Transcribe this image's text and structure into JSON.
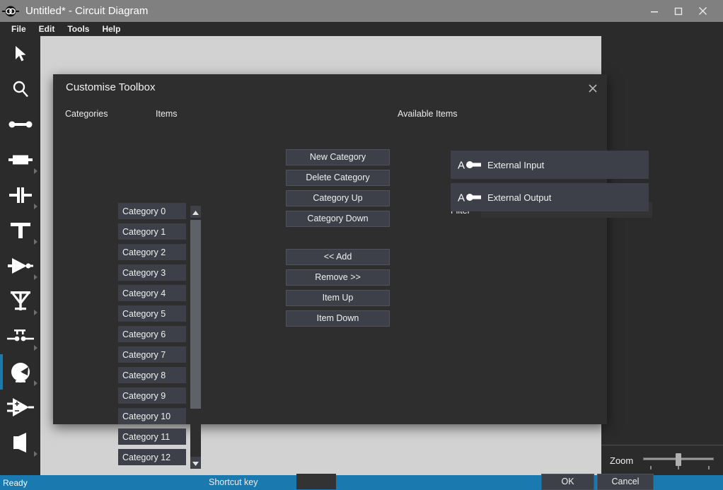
{
  "window": {
    "title": "Untitled* - Circuit Diagram",
    "logo_icon": "circuit-diagram-logo-icon",
    "minimize_icon": "minimize-icon",
    "maximize_icon": "maximize-icon",
    "close_icon": "close-icon"
  },
  "menubar": {
    "items": [
      {
        "label": "File"
      },
      {
        "label": "Edit"
      },
      {
        "label": "Tools"
      },
      {
        "label": "Help"
      }
    ]
  },
  "sidebar": {
    "tools": [
      {
        "name": "select-tool",
        "icon": "cursor-arrow-icon",
        "has_flyout": false,
        "selected": false
      },
      {
        "name": "zoom-tool",
        "icon": "magnifier-icon",
        "has_flyout": false,
        "selected": false
      },
      {
        "name": "wire-tool",
        "icon": "wire-icon",
        "has_flyout": false,
        "selected": false
      },
      {
        "name": "resistor-tool",
        "icon": "resistor-icon",
        "has_flyout": true,
        "selected": false
      },
      {
        "name": "capacitor-tool",
        "icon": "capacitor-icon",
        "has_flyout": true,
        "selected": false
      },
      {
        "name": "junction-tool",
        "icon": "t-junction-icon",
        "has_flyout": true,
        "selected": false
      },
      {
        "name": "buffer-tool",
        "icon": "buffer-triangle-icon",
        "has_flyout": true,
        "selected": false
      },
      {
        "name": "antenna-tool",
        "icon": "antenna-icon",
        "has_flyout": true,
        "selected": false
      },
      {
        "name": "switch-tool",
        "icon": "switch-icon",
        "has_flyout": true,
        "selected": false
      },
      {
        "name": "meter-tool",
        "icon": "meter-gauge-icon",
        "has_flyout": true,
        "selected": true
      },
      {
        "name": "opamp-tool",
        "icon": "op-amp-icon",
        "has_flyout": false,
        "selected": false
      },
      {
        "name": "speaker-tool",
        "icon": "speaker-icon",
        "has_flyout": true,
        "selected": false
      }
    ]
  },
  "zoom_control": {
    "label": "Zoom",
    "value": 50
  },
  "statusbar": {
    "text": "Ready"
  },
  "dialog": {
    "title": "Customise Toolbox",
    "close_icon": "close-icon",
    "headings": {
      "categories": "Categories",
      "items": "Items",
      "available_items": "Available Items"
    },
    "categories": [
      {
        "label": "Category 0"
      },
      {
        "label": "Category 1"
      },
      {
        "label": "Category 2"
      },
      {
        "label": "Category 3"
      },
      {
        "label": "Category 4"
      },
      {
        "label": "Category 5"
      },
      {
        "label": "Category 6"
      },
      {
        "label": "Category 7"
      },
      {
        "label": "Category 8"
      },
      {
        "label": "Category 9"
      },
      {
        "label": "Category 10"
      },
      {
        "label": "Category 11"
      },
      {
        "label": "Category 12"
      }
    ],
    "scrollbar": {
      "up_icon": "scroll-up-arrow-icon",
      "down_icon": "scroll-down-arrow-icon"
    },
    "category_buttons": [
      {
        "label": "New Category"
      },
      {
        "label": "Delete Category"
      },
      {
        "label": "Category Up"
      },
      {
        "label": "Category Down"
      }
    ],
    "item_buttons": [
      {
        "label": "<< Add"
      },
      {
        "label": "Remove >>"
      },
      {
        "label": "Item Up"
      },
      {
        "label": "Item Down"
      }
    ],
    "filter": {
      "label": "Filter",
      "value": "",
      "placeholder": ""
    },
    "available_items": [
      {
        "label": "External Input",
        "icon": "external-input-icon"
      },
      {
        "label": "External Output",
        "icon": "external-output-icon"
      }
    ],
    "shortcut": {
      "label": "Shortcut key",
      "value": "",
      "placeholder": ""
    },
    "ok_label": "OK",
    "cancel_label": "Cancel"
  },
  "colors": {
    "titlebar": "#808080",
    "chrome": "#2b2b2b",
    "dialog": "#2e2e2e",
    "control": "#3d4049",
    "canvas": "#d2d2d2",
    "accent": "#1a7ab0"
  }
}
